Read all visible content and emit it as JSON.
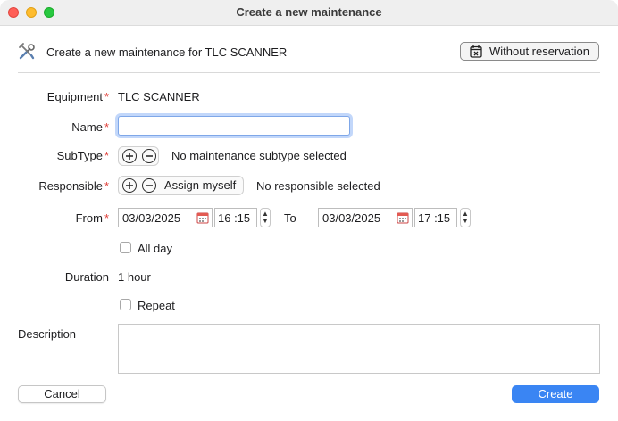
{
  "window": {
    "title": "Create a new maintenance"
  },
  "header": {
    "icon": "tools-icon",
    "text": "Create a new maintenance for TLC SCANNER",
    "without_reservation_label": "Without reservation",
    "without_reservation_icon": "calendar-x-icon"
  },
  "form": {
    "equipment": {
      "label": "Equipment",
      "value": "TLC SCANNER"
    },
    "name": {
      "label": "Name",
      "value": ""
    },
    "subtype": {
      "label": "SubType",
      "status": "No maintenance subtype selected"
    },
    "responsible": {
      "label": "Responsible",
      "assign_label": "Assign myself",
      "status": "No responsible selected"
    },
    "from": {
      "label": "From",
      "date": "03/03/2025",
      "time": "16 :15"
    },
    "to": {
      "label": "To",
      "date": "03/03/2025",
      "time": "17 :15"
    },
    "all_day": {
      "label": "All day",
      "checked": false
    },
    "duration": {
      "label": "Duration",
      "value": "1 hour"
    },
    "repeat": {
      "label": "Repeat",
      "checked": false
    },
    "description": {
      "label": "Description",
      "value": ""
    }
  },
  "footer": {
    "cancel_label": "Cancel",
    "create_label": "Create"
  },
  "colors": {
    "required": "#e0403a",
    "primary": "#3a85f3",
    "focus": "#7fa7e8"
  }
}
